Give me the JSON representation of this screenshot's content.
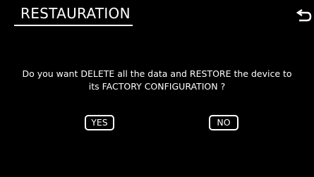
{
  "screen": {
    "title": "RESTAURATION",
    "back_icon": "return-arrow-icon"
  },
  "dialog": {
    "message_line1": "Do you want DELETE all the data and RESTORE the device to",
    "message_line2": "its FACTORY CONFIGURATION ?",
    "yes_label": "YES",
    "no_label": "NO"
  },
  "colors": {
    "background": "#000000",
    "foreground": "#ffffff"
  }
}
